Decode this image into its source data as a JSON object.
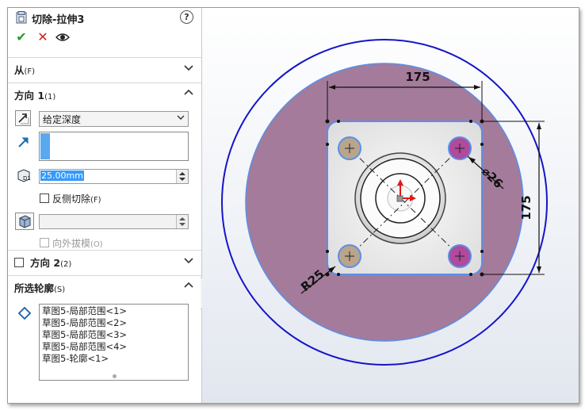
{
  "panel": {
    "title": "切除-拉伸3",
    "help": "?",
    "ok_symbol": "✔",
    "cancel_symbol": "✕",
    "preview_symbol": "👁"
  },
  "sections": {
    "from": {
      "title": "从",
      "suffix": "(F)",
      "expanded": false
    },
    "direction1": {
      "title": "方向 1",
      "suffix": "(1)",
      "expanded": true,
      "end_condition": "给定深度",
      "depth_value": "25.00mm",
      "flip_side_label": "反侧切除",
      "flip_side_suffix": "(F)",
      "flip_side_checked": false,
      "draft_outward_label": "向外拔模",
      "draft_outward_suffix": "(O)",
      "draft_outward_enabled": false
    },
    "direction2": {
      "title": "方向 2",
      "suffix": "(2)",
      "checked": false,
      "expanded": false
    },
    "selected_contours": {
      "title": "所选轮廓",
      "suffix": "(S)",
      "expanded": true,
      "items": [
        "草图5-局部范围<1>",
        "草图5-局部范围<2>",
        "草图5-局部范围<3>",
        "草图5-局部范围<4>",
        "草图5-轮廓<1>"
      ]
    }
  },
  "viewport": {
    "dim_horizontal": "175",
    "dim_vertical": "175",
    "dim_diameter": "⌀26",
    "dim_radius": "R25",
    "colors": {
      "face": "#a47b9b",
      "outer_circle": "#1515c8",
      "selection": "#5b8fe8",
      "hole_selected": "#b04a9a",
      "hole_tan": "#b9a48c",
      "origin_arrow": "#e01818"
    }
  }
}
